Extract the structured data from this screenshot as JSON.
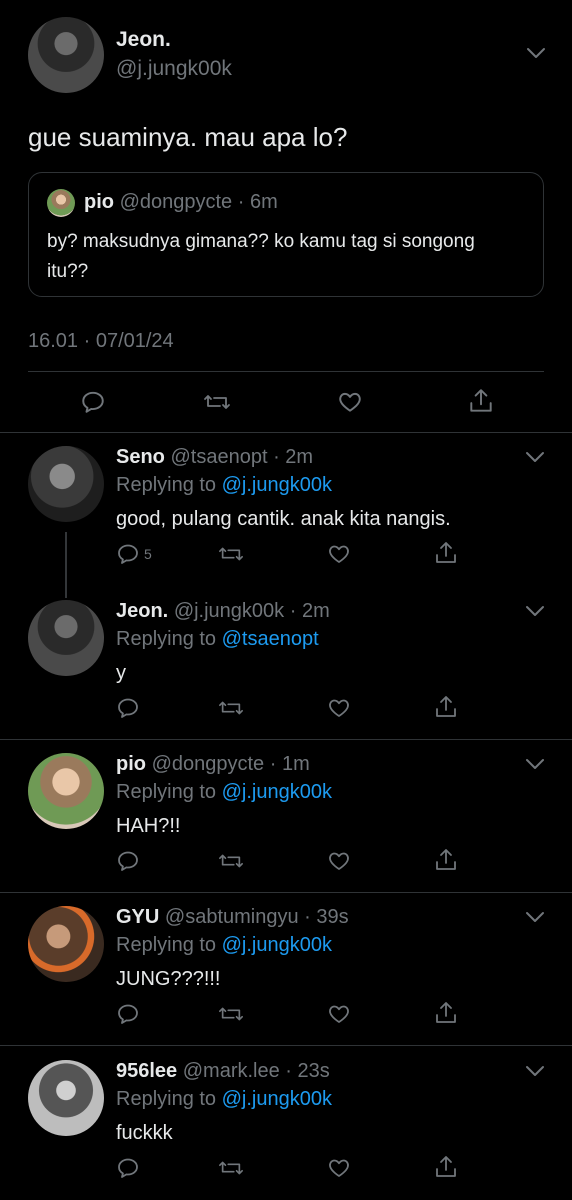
{
  "main_tweet": {
    "display_name": "Jeon.",
    "handle": "@j.jungk00k",
    "text": "gue suaminya. mau apa lo?",
    "time": "16.01 · 07/01/24",
    "quoted": {
      "display_name": "pio",
      "handle": "@dongpycte",
      "age": "· 6m",
      "text": "by? maksudnya gimana?? ko kamu tag si songong itu??"
    }
  },
  "replies": [
    {
      "display_name": "Seno",
      "handle": "@tsaenopt",
      "age": "· 2m",
      "replying_label": "Replying to",
      "replying_to": "@j.jungk00k",
      "text": "good, pulang cantik. anak kita nangis.",
      "reply_count": "5"
    },
    {
      "display_name": "Jeon.",
      "handle": "@j.jungk00k",
      "age": "· 2m",
      "replying_label": "Replying to",
      "replying_to": "@tsaenopt",
      "text": "y",
      "reply_count": ""
    },
    {
      "display_name": "pio",
      "handle": "@dongpycte",
      "age": "· 1m",
      "replying_label": "Replying to",
      "replying_to": "@j.jungk00k",
      "text": "HAH?!!",
      "reply_count": ""
    },
    {
      "display_name": "GYU",
      "handle": "@sabtumingyu",
      "age": "· 39s",
      "replying_label": "Replying to",
      "replying_to": "@j.jungk00k",
      "text": "JUNG???!!!",
      "reply_count": ""
    },
    {
      "display_name": "956lee",
      "handle": "@mark.lee",
      "age": "· 23s",
      "replying_label": "Replying to",
      "replying_to": "@j.jungk00k",
      "text": "fuckkk",
      "reply_count": ""
    }
  ],
  "icons": {
    "reply": "reply-icon",
    "retweet": "retweet-icon",
    "like": "like-icon",
    "share": "share-icon",
    "more": "chevron-down-icon"
  },
  "colors": {
    "background": "#000000",
    "text": "#e7e9ea",
    "muted": "#71767b",
    "link": "#1d9bf0",
    "divider": "#2f3336"
  }
}
